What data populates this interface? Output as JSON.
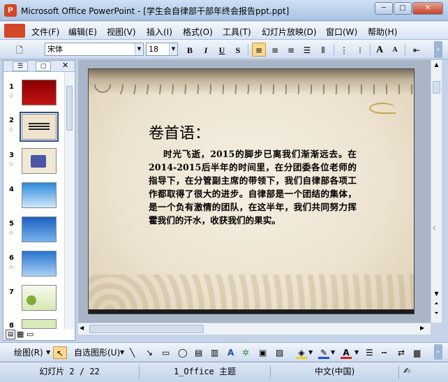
{
  "window": {
    "app_icon": "P",
    "title": "Microsoft Office PowerPoint - [学生会自律部干部年终会报告ppt.ppt]",
    "minimize": "─",
    "maximize": "□",
    "close": "✕"
  },
  "menu": {
    "items": [
      {
        "label": "文件(F)"
      },
      {
        "label": "编辑(E)"
      },
      {
        "label": "视图(V)"
      },
      {
        "label": "插入(I)"
      },
      {
        "label": "格式(O)"
      },
      {
        "label": "工具(T)"
      },
      {
        "label": "幻灯片放映(D)"
      },
      {
        "label": "窗口(W)"
      },
      {
        "label": "帮助(H)"
      }
    ]
  },
  "toolbar": {
    "font_name": "宋体",
    "font_size": "18",
    "bold": "B",
    "italic": "I",
    "underline": "U",
    "shadow": "S",
    "grow_font": "A",
    "shrink_font": "A",
    "active_color": "#fbd88c"
  },
  "slides_pane": {
    "slides": [
      {
        "number": "1",
        "star": "☆"
      },
      {
        "number": "2",
        "star": "☆"
      },
      {
        "number": "3",
        "star": "☆"
      },
      {
        "number": "4",
        "star": ""
      },
      {
        "number": "5",
        "star": "☆"
      },
      {
        "number": "6",
        "star": "☆"
      },
      {
        "number": "7",
        "star": ""
      },
      {
        "number": "8",
        "star": ""
      }
    ],
    "selected": 2,
    "close": "✕"
  },
  "slide": {
    "title": "卷首语：",
    "body": "时光飞逝，2015的脚步已离我们渐渐远去。在2014-2015后半年的时间里，在分团委各位老师的指导下，在分管副主席的带领下，我们自律部各项工作都取得了很大的进步。自律部是一个团结的集体，是一个负有激情的团队，在这半年，我们共同努力挥霍我们的汗水，收获我们的果实。"
  },
  "drawing_toolbar": {
    "draw_label": "绘图(R)",
    "autoshapes_label": "自选图形(U)"
  },
  "status": {
    "slide_info": "幻灯片 2 / 22",
    "theme": "1_Office 主题",
    "language": "中文(中国)"
  }
}
